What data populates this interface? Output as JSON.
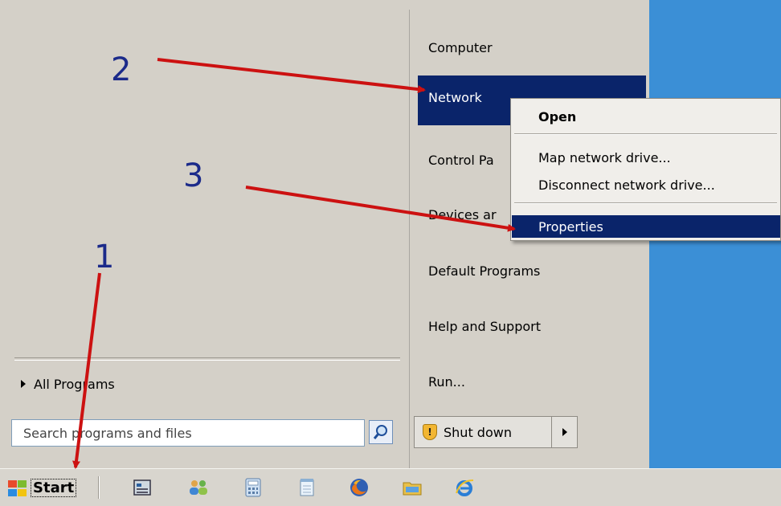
{
  "start_menu": {
    "all_programs_label": "All Programs",
    "search_placeholder": "Search programs and files",
    "right_items": [
      {
        "label": "Computer"
      },
      {
        "label": "Network"
      },
      {
        "label": "Control Pa"
      },
      {
        "label": "Devices ar"
      },
      {
        "label": "Default Programs"
      },
      {
        "label": "Help and Support"
      },
      {
        "label": "Run..."
      }
    ],
    "shutdown_label": "Shut down"
  },
  "context_menu": {
    "items": [
      {
        "label": "Open",
        "bold": true
      },
      {
        "label": "Map network drive..."
      },
      {
        "label": "Disconnect network drive..."
      },
      {
        "label": "Properties",
        "selected": true
      }
    ]
  },
  "taskbar": {
    "start_label": "Start",
    "icons": [
      "server-manager-icon",
      "users-icon",
      "calculator-icon",
      "notepad-icon",
      "firefox-icon",
      "explorer-folder-icon",
      "internet-explorer-icon"
    ]
  },
  "annotations": {
    "step1": "1",
    "step2": "2",
    "step3": "3"
  },
  "colors": {
    "selection": "#0a246a",
    "arrow": "#cc1111",
    "step_number": "#1b2a8a",
    "desktop": "#3b8fd6"
  }
}
